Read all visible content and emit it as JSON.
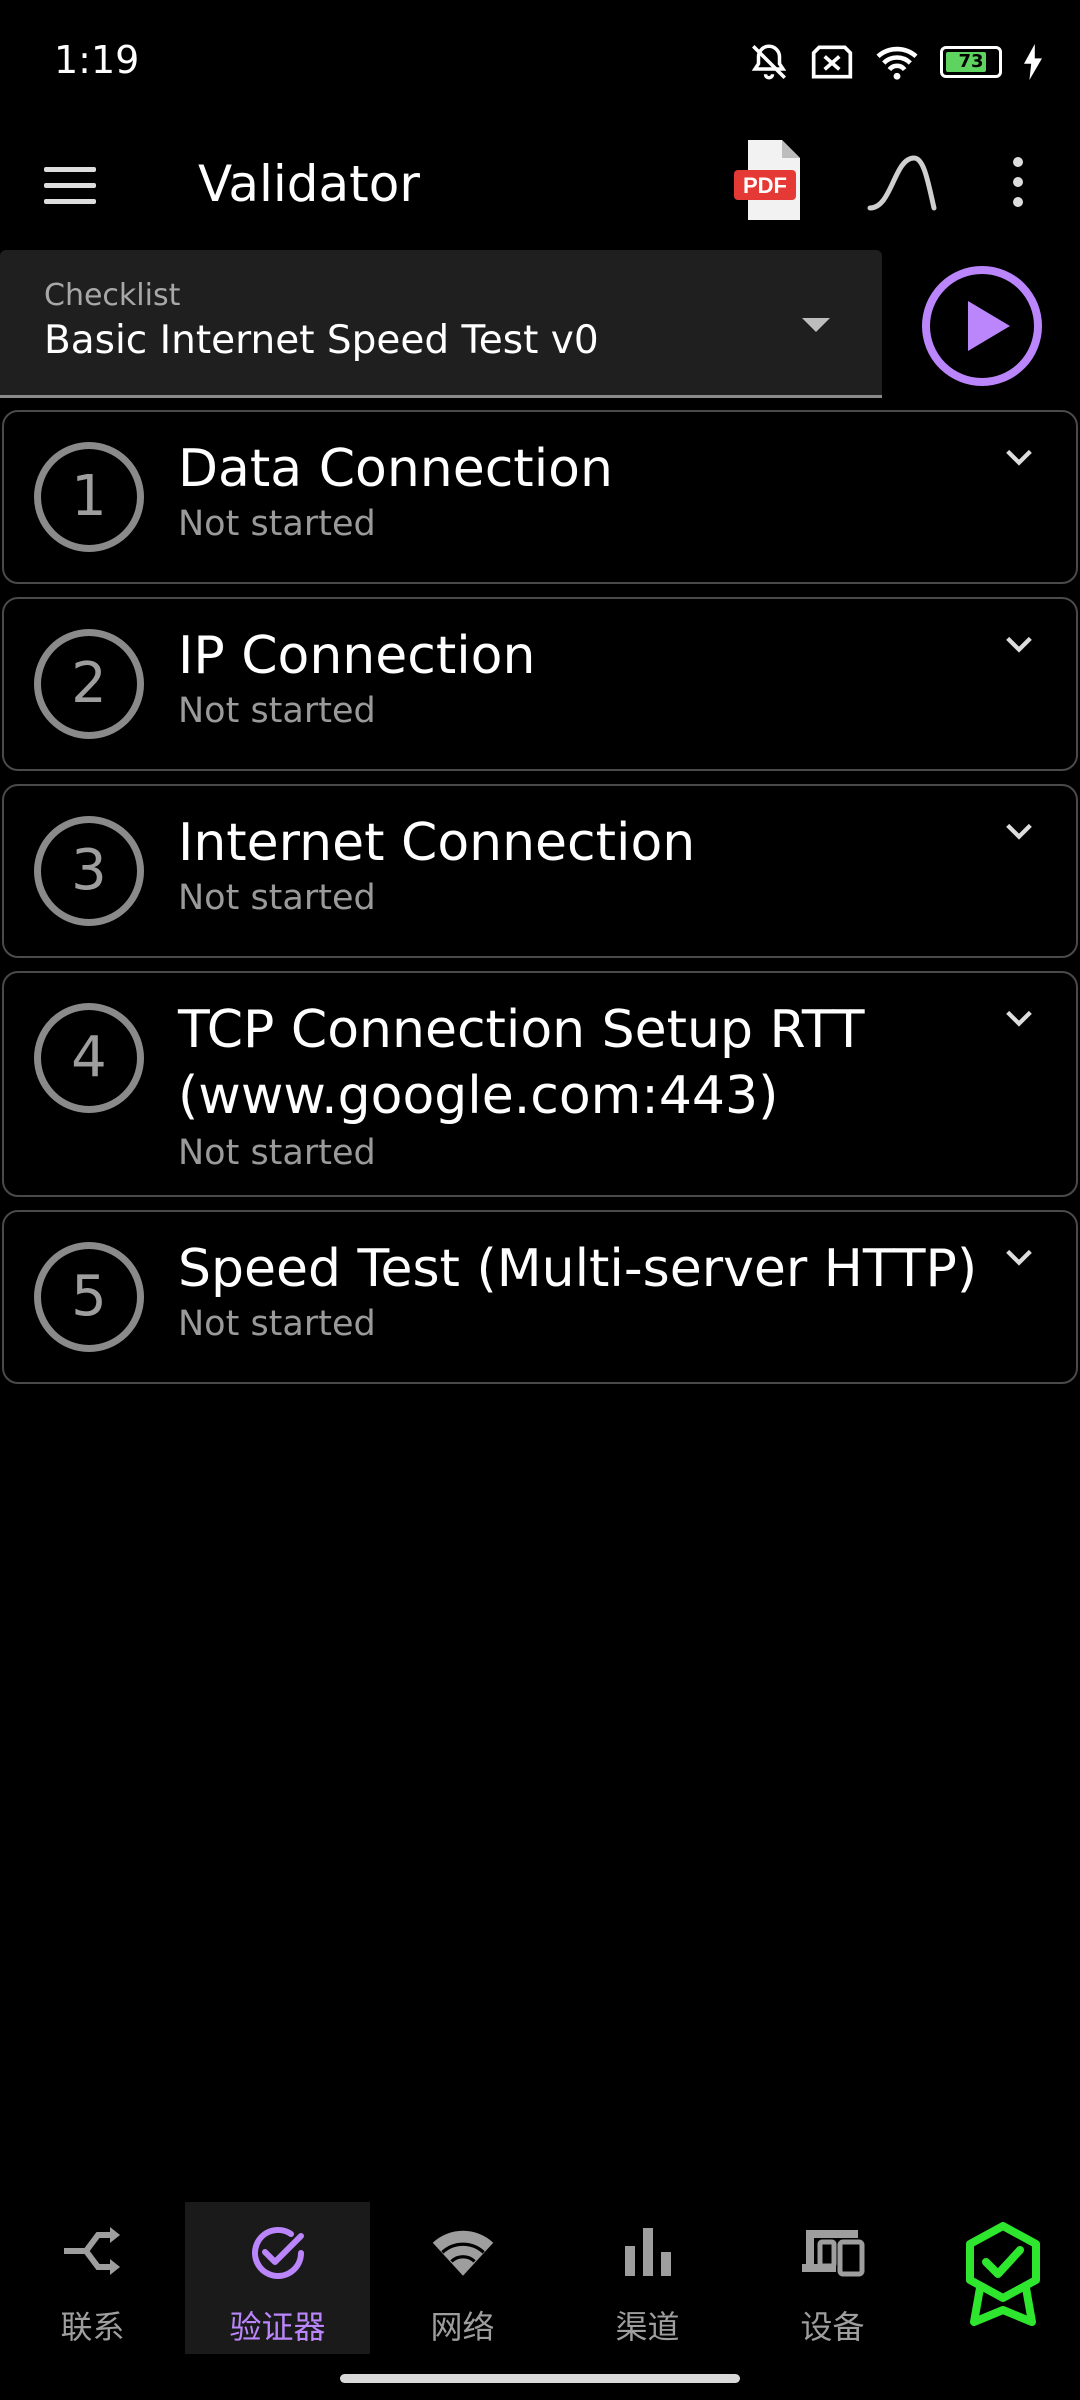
{
  "status_bar": {
    "time": "1:19",
    "battery": "73"
  },
  "toolbar": {
    "title": "Validator",
    "pdf_label": "PDF"
  },
  "checklist": {
    "label": "Checklist",
    "value": "Basic Internet Speed Test v0"
  },
  "steps": [
    {
      "number": "1",
      "title": "Data Connection",
      "status": "Not started"
    },
    {
      "number": "2",
      "title": "IP Connection",
      "status": "Not started"
    },
    {
      "number": "3",
      "title": "Internet Connection",
      "status": "Not started"
    },
    {
      "number": "4",
      "title_line1": "TCP Connection Setup RTT",
      "title_line2": "(www.google.com:443)",
      "status": "Not started"
    },
    {
      "number": "5",
      "title": "Speed Test (Multi-server HTTP)",
      "status": "Not started"
    }
  ],
  "bottom_nav": {
    "items": [
      {
        "label": "联系",
        "icon": "connect-icon"
      },
      {
        "label": "验证器",
        "icon": "check-circle-icon",
        "active": true
      },
      {
        "label": "网络",
        "icon": "wifi-icon"
      },
      {
        "label": "渠道",
        "icon": "bar-chart-icon"
      },
      {
        "label": "设备",
        "icon": "devices-icon"
      }
    ],
    "badge_icon": "award-badge-icon"
  },
  "colors": {
    "accent": "#bb86fc",
    "badge": "#2fe62f",
    "pdf_red": "#e53935"
  }
}
